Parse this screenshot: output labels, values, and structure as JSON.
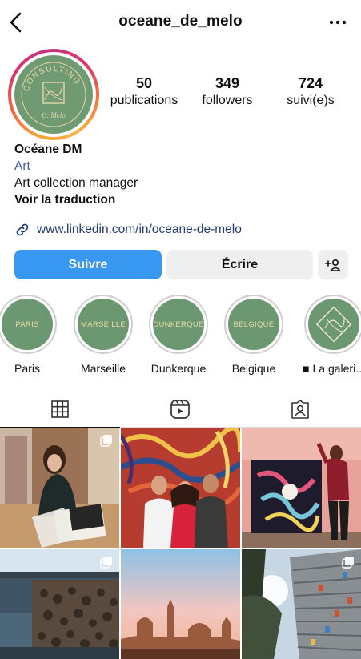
{
  "header": {
    "username": "oceane_de_melo"
  },
  "profile": {
    "avatar_text_top": "CONSULTING",
    "avatar_text_bottom": "O. Melo",
    "stats": [
      {
        "value": "50",
        "label": "publications"
      },
      {
        "value": "349",
        "label": "followers"
      },
      {
        "value": "724",
        "label": "suivi(e)s"
      }
    ],
    "name": "Océane DM",
    "category": "Art",
    "bio": "Art collection manager",
    "translate": "Voir la traduction",
    "link": "www.linkedin.com/in/oceane-de-melo"
  },
  "actions": {
    "follow": "Suivre",
    "message": "Écrire"
  },
  "highlights": [
    {
      "cover": "PARIS",
      "label": "Paris"
    },
    {
      "cover": "MARSEILLE",
      "label": "Marseille"
    },
    {
      "cover": "DUNKERQUE",
      "label": "Dunkerque"
    },
    {
      "cover": "BELGIQUE",
      "label": "Belgique"
    },
    {
      "cover": "",
      "label": "■ La galeri..."
    }
  ],
  "tabs": [
    "grid-icon",
    "reels-icon",
    "tagged-icon"
  ],
  "colors": {
    "follow_blue": "#3897f0",
    "highlight_green": "#6b9870",
    "link": "#1f3a72"
  }
}
